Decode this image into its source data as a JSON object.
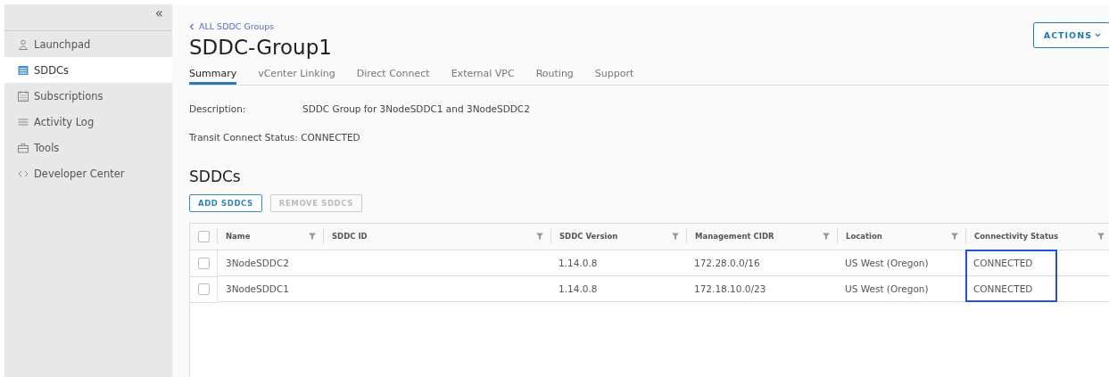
{
  "sidebar": {
    "collapse_glyph": "«",
    "items": [
      {
        "label": "Launchpad",
        "selected": false
      },
      {
        "label": "SDDCs",
        "selected": true
      },
      {
        "label": "Subscriptions",
        "selected": false
      },
      {
        "label": "Activity Log",
        "selected": false
      },
      {
        "label": "Tools",
        "selected": false
      },
      {
        "label": "Developer Center",
        "selected": false
      }
    ]
  },
  "breadcrumb": "ALL SDDC Groups",
  "title": "SDDC-Group1",
  "actions_button": "ACTIONS",
  "tabs": [
    {
      "label": "Summary",
      "selected": true
    },
    {
      "label": "vCenter Linking",
      "selected": false
    },
    {
      "label": "Direct Connect",
      "selected": false
    },
    {
      "label": "External VPC",
      "selected": false
    },
    {
      "label": "Routing",
      "selected": false
    },
    {
      "label": "Support",
      "selected": false
    }
  ],
  "description": {
    "label": "Description:",
    "value": "SDDC Group for 3NodeSDDC1 and 3NodeSDDC2"
  },
  "transit_status": "Transit Connect Status: CONNECTED",
  "section_title": "SDDCs",
  "buttons": [
    {
      "label": "ADD SDDCS",
      "disabled": false
    },
    {
      "label": "REMOVE SDDCS",
      "disabled": true
    }
  ],
  "table": {
    "all_checked": false,
    "columns": [
      {
        "label": "Name",
        "highlighted": false
      },
      {
        "label": "SDDC ID",
        "highlighted": false
      },
      {
        "label": "SDDC Version",
        "highlighted": false
      },
      {
        "label": "Management CIDR",
        "highlighted": false
      },
      {
        "label": "Location",
        "highlighted": false
      },
      {
        "label": "Connectivity Status",
        "highlighted": true
      }
    ],
    "rows": [
      {
        "checked": false,
        "cells": [
          "3NodeSDDC2",
          "",
          "1.14.0.8",
          "172.28.0.0/16",
          "US West (Oregon)",
          "CONNECTED"
        ]
      },
      {
        "checked": false,
        "cells": [
          "3NodeSDDC1",
          "",
          "1.14.0.8",
          "172.18.10.0/23",
          "US West (Oregon)",
          "CONNECTED"
        ]
      }
    ]
  }
}
